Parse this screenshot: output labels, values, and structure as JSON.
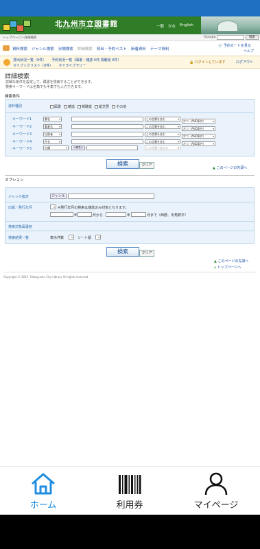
{
  "header": {
    "title": "北九州市立図書館",
    "subtitle": "KITAKYUSHU CITY LIBRARY",
    "lang_links": [
      "一般",
      "かな",
      "English"
    ]
  },
  "breadcrumb": "トップページ＞詳細検索",
  "google_search": {
    "label": "Google",
    "button": "検索"
  },
  "nav": {
    "items": [
      "資料検索",
      "ジャンル検索",
      "分類検索",
      "詳細検索",
      "貸出・予約ベスト",
      "新着資料",
      "テーマ資料"
    ],
    "current_index": 3,
    "cart": "予約カートを見る",
    "help": "ヘルプ"
  },
  "user": {
    "line1": [
      "貸出状況一覧（0件）",
      "予約状況一覧（図書・雑誌 0件,視聴覚 0件）"
    ],
    "line2": [
      "マイブックリスト（0件）",
      "マイライブラリー"
    ],
    "login_status": "ログインしています",
    "logout": "ログアウト"
  },
  "page": {
    "title": "詳細検索",
    "intro_line1": "詳細な条件を設定して、蔵書を検索することができます。",
    "intro_line2": "検索キーワードは全角でも半角でも入力できます。"
  },
  "conditions": {
    "section_label": "検索条件",
    "material_type_label": "資料種別",
    "material_types": [
      "図書",
      "雑誌",
      "視聴覚",
      "紙芝居",
      "その他"
    ],
    "keyword_rows": [
      {
        "label": "キーワード1",
        "field": "書名",
        "match": "この言葉を含む",
        "logic": "かつ（AND条件）"
      },
      {
        "label": "キーワード2",
        "field": "著者名",
        "match": "この言葉を含む",
        "logic": "かつ（AND条件）"
      },
      {
        "label": "キーワード3",
        "field": "出版者",
        "match": "この言葉を含む",
        "logic": "かつ（AND条件）"
      },
      {
        "label": "キーワード4",
        "field": "件名",
        "match": "この言葉を含む",
        "logic": "かつ（AND条件）"
      },
      {
        "label": "キーワード5",
        "field": "分類",
        "match": "この言葉で始まる",
        "logic": ""
      }
    ],
    "classification_button": "分類表示",
    "search_button": "検索",
    "clear_button": "クリア"
  },
  "page_top_link": "このページの先頭へ",
  "options": {
    "section_label": "オプション",
    "genre_label": "ジャンル指定",
    "genre_button": "ジャンル",
    "pub_year_label": "出版／発行年月",
    "pub_year_note": "※発行年月の検索は雑誌のみ対象となります。",
    "year_unit": "年",
    "month_from": "月から",
    "month_to": "月まで（西暦、半角数字）",
    "library_label": "検索対象図書館",
    "results_label": "検索結果一覧",
    "display_count_label": "表示件数",
    "sort_label": "ソート順",
    "search_button": "検索",
    "clear_button": "クリア"
  },
  "footer_links": {
    "page_top": "このページの先頭へ",
    "top_page": "トップページへ"
  },
  "copyright": "Copyright © 2012- Kitakyushu City Library All rights reserved.",
  "bottom_nav": [
    {
      "label": "ホーム",
      "icon": "home-icon",
      "active": true
    },
    {
      "label": "利用券",
      "icon": "barcode-icon",
      "active": false
    },
    {
      "label": "マイページ",
      "icon": "person-icon",
      "active": false
    }
  ],
  "colors": {
    "accent": "#1f8ee0",
    "header_green": "#2f7d27",
    "status_blue": "#1f6fc2",
    "panel": "#eaf3fb"
  }
}
